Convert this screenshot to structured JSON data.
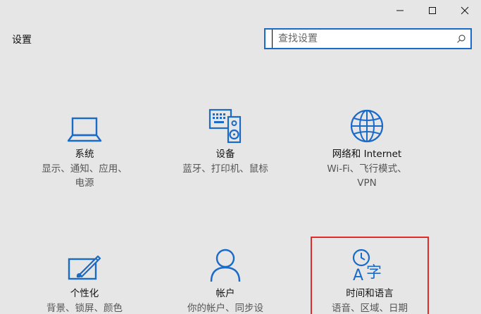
{
  "window": {
    "minimize_icon": "minimize-icon",
    "maximize_icon": "maximize-icon",
    "close_icon": "close-icon"
  },
  "header": {
    "title": "设置"
  },
  "search": {
    "placeholder": "查找设置",
    "icon": "search-icon"
  },
  "tiles": [
    {
      "icon": "laptop-icon",
      "title": "系统",
      "desc": "显示、通知、应用、电源"
    },
    {
      "icon": "devices-icon",
      "title": "设备",
      "desc": "蓝牙、打印机、鼠标"
    },
    {
      "icon": "globe-icon",
      "title": "网络和 Internet",
      "desc": "Wi-Fi、飞行模式、VPN"
    },
    {
      "icon": "personalization-icon",
      "title": "个性化",
      "desc": "背景、锁屏、颜色"
    },
    {
      "icon": "account-icon",
      "title": "帐户",
      "desc": "你的帐户、同步设置、"
    },
    {
      "icon": "time-language-icon",
      "title": "时间和语言",
      "desc": "语音、区域、日期"
    }
  ],
  "colors": {
    "accent": "#1a6ac8",
    "highlight": "#e02b2b",
    "background": "#e6e6e6"
  }
}
